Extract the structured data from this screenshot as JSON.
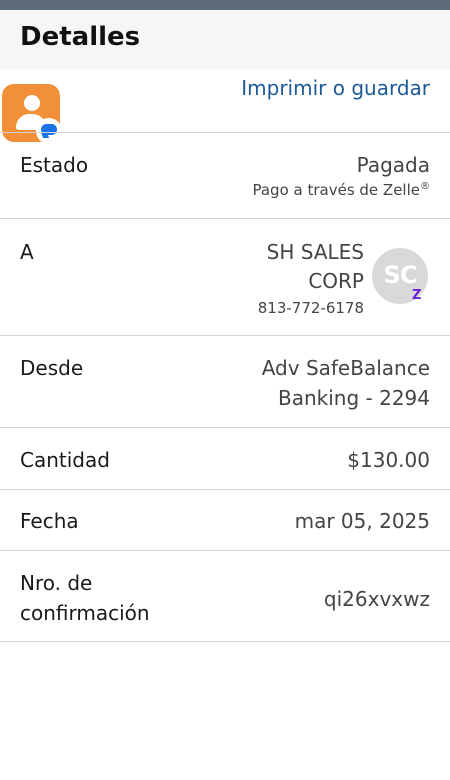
{
  "header": {
    "title": "Detalles"
  },
  "actions": {
    "print_label": "Imprimir o guardar"
  },
  "details": {
    "status": {
      "label": "Estado",
      "value": "Pagada",
      "sub": "Pago a través de Zelle",
      "sub_mark": "®"
    },
    "recipient": {
      "label": "A",
      "name_line1": "SH SALES",
      "name_line2": "CORP",
      "phone": "813-772-6178",
      "avatar_initials": "SC",
      "badge": "Z"
    },
    "from": {
      "label": "Desde",
      "value_line1": "Adv SafeBalance",
      "value_line2": "Banking - 2294"
    },
    "amount": {
      "label": "Cantidad",
      "value": "$130.00"
    },
    "date": {
      "label": "Fecha",
      "value": "mar 05, 2025"
    },
    "confirmation": {
      "label_line1": "Nro. de",
      "label_line2": "confirmación",
      "value": "qi26xvxwz"
    }
  },
  "colors": {
    "accent": "#1e5a96",
    "app_icon": "#f2903a",
    "zelle": "#6d1ed4"
  },
  "icons": {
    "app": "contact-message-icon"
  }
}
